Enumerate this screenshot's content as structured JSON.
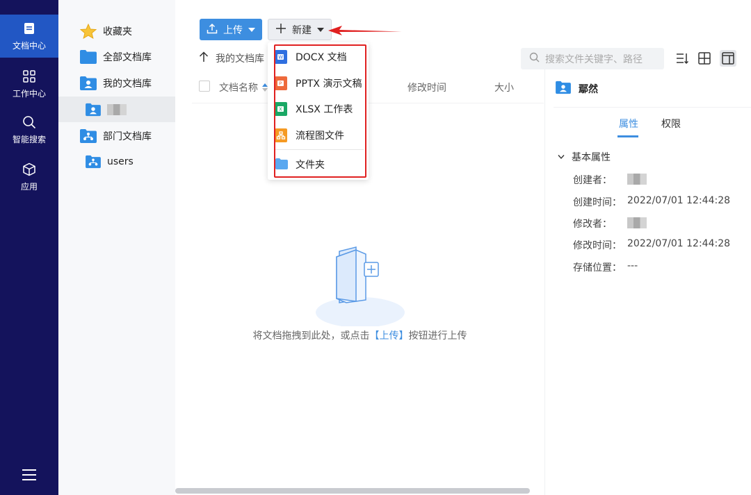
{
  "nav": {
    "items": [
      {
        "label": "文档中心",
        "icon": "document-icon"
      },
      {
        "label": "工作中心",
        "icon": "grid-icon"
      },
      {
        "label": "智能搜索",
        "icon": "search-icon"
      },
      {
        "label": "应用",
        "icon": "cube-icon"
      }
    ],
    "active": "文档中心"
  },
  "tree": {
    "items": [
      {
        "label": "收藏夹",
        "icon": "star-icon"
      },
      {
        "label": "全部文档库",
        "icon": "folder-icon"
      },
      {
        "label": "我的文档库",
        "icon": "user-folder-icon"
      },
      {
        "label": "",
        "icon": "user-folder-icon"
      },
      {
        "label": "部门文档库",
        "icon": "org-folder-icon"
      },
      {
        "label": "users",
        "icon": "org-folder-icon"
      }
    ]
  },
  "toolbar": {
    "upload_label": "上传",
    "new_label": "新建",
    "search_placeholder": "搜索文件关键字、路径"
  },
  "breadcrumb": {
    "label": "我的文档库"
  },
  "table": {
    "columns": {
      "name": "文档名称",
      "modified": "修改时间",
      "size": "大小"
    }
  },
  "empty": {
    "text_before": "将文档拖拽到此处，或点击",
    "text_link": "【上传】",
    "text_after": "按钮进行上传"
  },
  "new_menu": {
    "items": [
      {
        "label": "DOCX 文档",
        "icon": "docx-icon",
        "color": "#2f6fe0"
      },
      {
        "label": "PPTX 演示文稿",
        "icon": "pptx-icon",
        "color": "#ee6a3c"
      },
      {
        "label": "XLSX 工作表",
        "icon": "xlsx-icon",
        "color": "#1aa865"
      },
      {
        "label": "流程图文件",
        "icon": "flowchart-icon",
        "color": "#f59a23"
      },
      {
        "label": "文件夹",
        "icon": "folder-icon",
        "color": "#5aa8f0"
      }
    ]
  },
  "detail": {
    "title": "鄢然",
    "tabs": {
      "attributes": "属性",
      "permissions": "权限"
    },
    "section": "基本属性",
    "fields": [
      {
        "label": "创建者：",
        "value": ""
      },
      {
        "label": "创建时间：",
        "value": "2022/07/01 12:44:28"
      },
      {
        "label": "修改者：",
        "value": ""
      },
      {
        "label": "修改时间：",
        "value": "2022/07/01 12:44:28"
      },
      {
        "label": "存储位置：",
        "value": "---"
      }
    ]
  },
  "colors": {
    "nav_bg": "#14135c",
    "nav_active": "#2257c4",
    "accent": "#3d8ee0",
    "annotation": "#e02020"
  }
}
